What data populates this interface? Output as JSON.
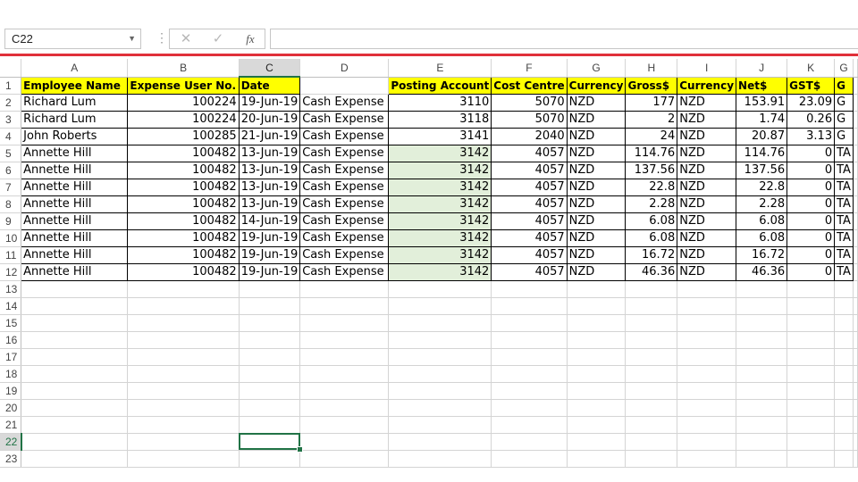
{
  "name_box": "C22",
  "formula": "",
  "icons": {
    "cancel": "close-icon",
    "enter": "check-icon",
    "function": "fx-icon",
    "dropdown": "chevron-down-icon"
  },
  "selected_column": "C",
  "selected_row": "22",
  "columns": [
    "A",
    "B",
    "C",
    "D",
    "E",
    "F",
    "G",
    "H",
    "I",
    "J",
    "K",
    "G"
  ],
  "headers": [
    "Employee Name",
    "Expense User No.",
    "Date",
    "",
    "Posting Account",
    "Cost Centre",
    "Currency",
    "Gross$",
    "Currency",
    "Net$",
    "GST$",
    "G"
  ],
  "rows": [
    [
      "Richard Lum",
      "100224",
      "19-Jun-19",
      "Cash Expense",
      "3110",
      "5070",
      "NZD",
      "177",
      "NZD",
      "153.91",
      "23.09",
      "G"
    ],
    [
      "Richard Lum",
      "100224",
      "20-Jun-19",
      "Cash Expense",
      "3118",
      "5070",
      "NZD",
      "2",
      "NZD",
      "1.74",
      "0.26",
      "G"
    ],
    [
      "John Roberts",
      "100285",
      "21-Jun-19",
      "Cash Expense",
      "3141",
      "2040",
      "NZD",
      "24",
      "NZD",
      "20.87",
      "3.13",
      "G"
    ],
    [
      "Annette Hill",
      "100482",
      "13-Jun-19",
      "Cash Expense",
      "3142",
      "4057",
      "NZD",
      "114.76",
      "NZD",
      "114.76",
      "0",
      "TA"
    ],
    [
      "Annette Hill",
      "100482",
      "13-Jun-19",
      "Cash Expense",
      "3142",
      "4057",
      "NZD",
      "137.56",
      "NZD",
      "137.56",
      "0",
      "TA"
    ],
    [
      "Annette Hill",
      "100482",
      "13-Jun-19",
      "Cash Expense",
      "3142",
      "4057",
      "NZD",
      "22.8",
      "NZD",
      "22.8",
      "0",
      "TA"
    ],
    [
      "Annette Hill",
      "100482",
      "13-Jun-19",
      "Cash Expense",
      "3142",
      "4057",
      "NZD",
      "2.28",
      "NZD",
      "2.28",
      "0",
      "TA"
    ],
    [
      "Annette Hill",
      "100482",
      "14-Jun-19",
      "Cash Expense",
      "3142",
      "4057",
      "NZD",
      "6.08",
      "NZD",
      "6.08",
      "0",
      "TA"
    ],
    [
      "Annette Hill",
      "100482",
      "19-Jun-19",
      "Cash Expense",
      "3142",
      "4057",
      "NZD",
      "6.08",
      "NZD",
      "6.08",
      "0",
      "TA"
    ],
    [
      "Annette Hill",
      "100482",
      "19-Jun-19",
      "Cash Expense",
      "3142",
      "4057",
      "NZD",
      "16.72",
      "NZD",
      "16.72",
      "0",
      "TA"
    ],
    [
      "Annette Hill",
      "100482",
      "19-Jun-19",
      "Cash Expense",
      "3142",
      "4057",
      "NZD",
      "46.36",
      "NZD",
      "46.36",
      "0",
      "TA"
    ]
  ],
  "empty_rows": [
    "13",
    "14",
    "15",
    "16",
    "17",
    "18",
    "19",
    "20",
    "21",
    "22",
    "23"
  ],
  "colors": {
    "header_fill": "#ffff00",
    "highlight_fill": "#e2efda",
    "accent": "#217346",
    "top_bar": "#e0303a"
  }
}
